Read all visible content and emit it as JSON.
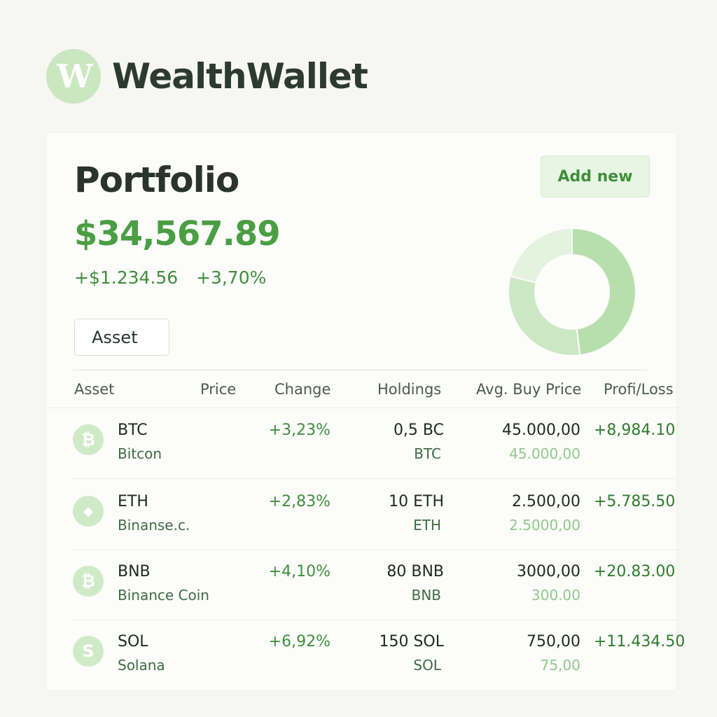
{
  "app": {
    "logo_letter": "W",
    "name": "WealthWallet"
  },
  "portfolio": {
    "title": "Portfolio",
    "total": "$34,567.89",
    "change_abs": "+$1.234.56",
    "change_pct": "+3,70%",
    "add_button": "Add new",
    "asset_filter": "Asset",
    "allocation_chart": {
      "type": "pie",
      "segments": [
        {
          "fraction": 0.48,
          "color": "#b7dfae"
        },
        {
          "fraction": 0.31,
          "color": "#cbe8c4"
        },
        {
          "fraction": 0.21,
          "color": "#e3f3de"
        }
      ]
    }
  },
  "table": {
    "headers": {
      "asset": "Asset",
      "price": "Price",
      "change": "Change",
      "holdings": "Holdings",
      "avg_buy": "Avg. Buy Price",
      "profit_loss": "Profi/Loss"
    },
    "rows": [
      {
        "icon": "bitcoin-icon",
        "glyph": "₿",
        "symbol": "BTC",
        "name": "Bitcon",
        "change": "+3,23%",
        "holdings": "0,5 BC",
        "holdings_unit": "BTC",
        "avg_buy": "45.000,00",
        "avg_buy_sub": "45.000,00",
        "pl": "+8,984.10"
      },
      {
        "icon": "ethereum-icon",
        "glyph": "◆",
        "symbol": "ETH",
        "name": "Binanse.c.",
        "change": "+2,83%",
        "holdings": "10 ETH",
        "holdings_unit": "ETH",
        "avg_buy": "2.500,00",
        "avg_buy_sub": "2.5000,00",
        "pl": "+5.785.50"
      },
      {
        "icon": "bnb-icon",
        "glyph": "₿",
        "symbol": "BNB",
        "name": "Binance Coin",
        "change": "+4,10%",
        "holdings": "80 BNB",
        "holdings_unit": "BNB",
        "avg_buy": "3000,00",
        "avg_buy_sub": "300.00",
        "pl": "+20.83.00"
      },
      {
        "icon": "solana-icon",
        "glyph": "S",
        "symbol": "SOL",
        "name": "Solana",
        "change": "+6,92%",
        "holdings": "150 SOL",
        "holdings_unit": "SOL",
        "avg_buy": "750,00",
        "avg_buy_sub": "75,00",
        "pl": "+11.434.50"
      }
    ]
  }
}
